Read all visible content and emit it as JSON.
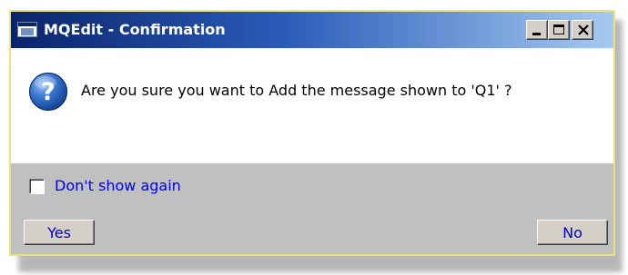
{
  "window": {
    "title": "MQEdit - Confirmation",
    "controls": {
      "minimize": "minimize",
      "maximize": "maximize",
      "close": "close"
    }
  },
  "content": {
    "icon": "question-icon",
    "message": "Are you sure you want to Add the message shown to 'Q1' ?"
  },
  "footer": {
    "checkbox_label": "Don't show again",
    "checkbox_checked": false,
    "yes_label": "Yes",
    "no_label": "No"
  },
  "colors": {
    "title_start": "#0a246a",
    "title_end": "#a6caf0",
    "window_border": "#e9e27a",
    "footer_bg": "#c0c0c0",
    "link_blue": "#0000ee"
  }
}
